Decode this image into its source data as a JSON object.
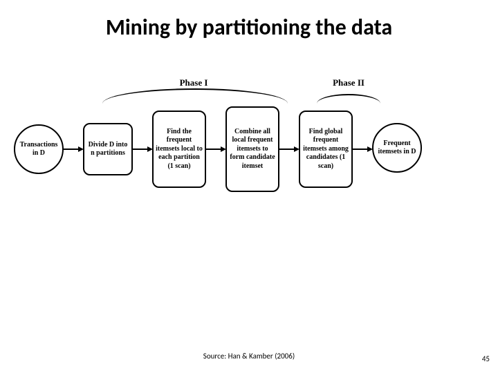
{
  "title": "Mining by partitioning the data",
  "phases": {
    "phase1": "Phase I",
    "phase2": "Phase II"
  },
  "nodes": {
    "start": "Transactions in D",
    "step1": "Divide D into n partitions",
    "step2": "Find the frequent itemsets local to each partition (1 scan)",
    "step3": "Combine all local frequent itemsets to form candidate itemset",
    "step4": "Find global frequent itemsets among candidates (1 scan)",
    "end": "Frequent itemsets in D"
  },
  "source": "Source: Han & Kamber (2006)",
  "page_number": "45"
}
